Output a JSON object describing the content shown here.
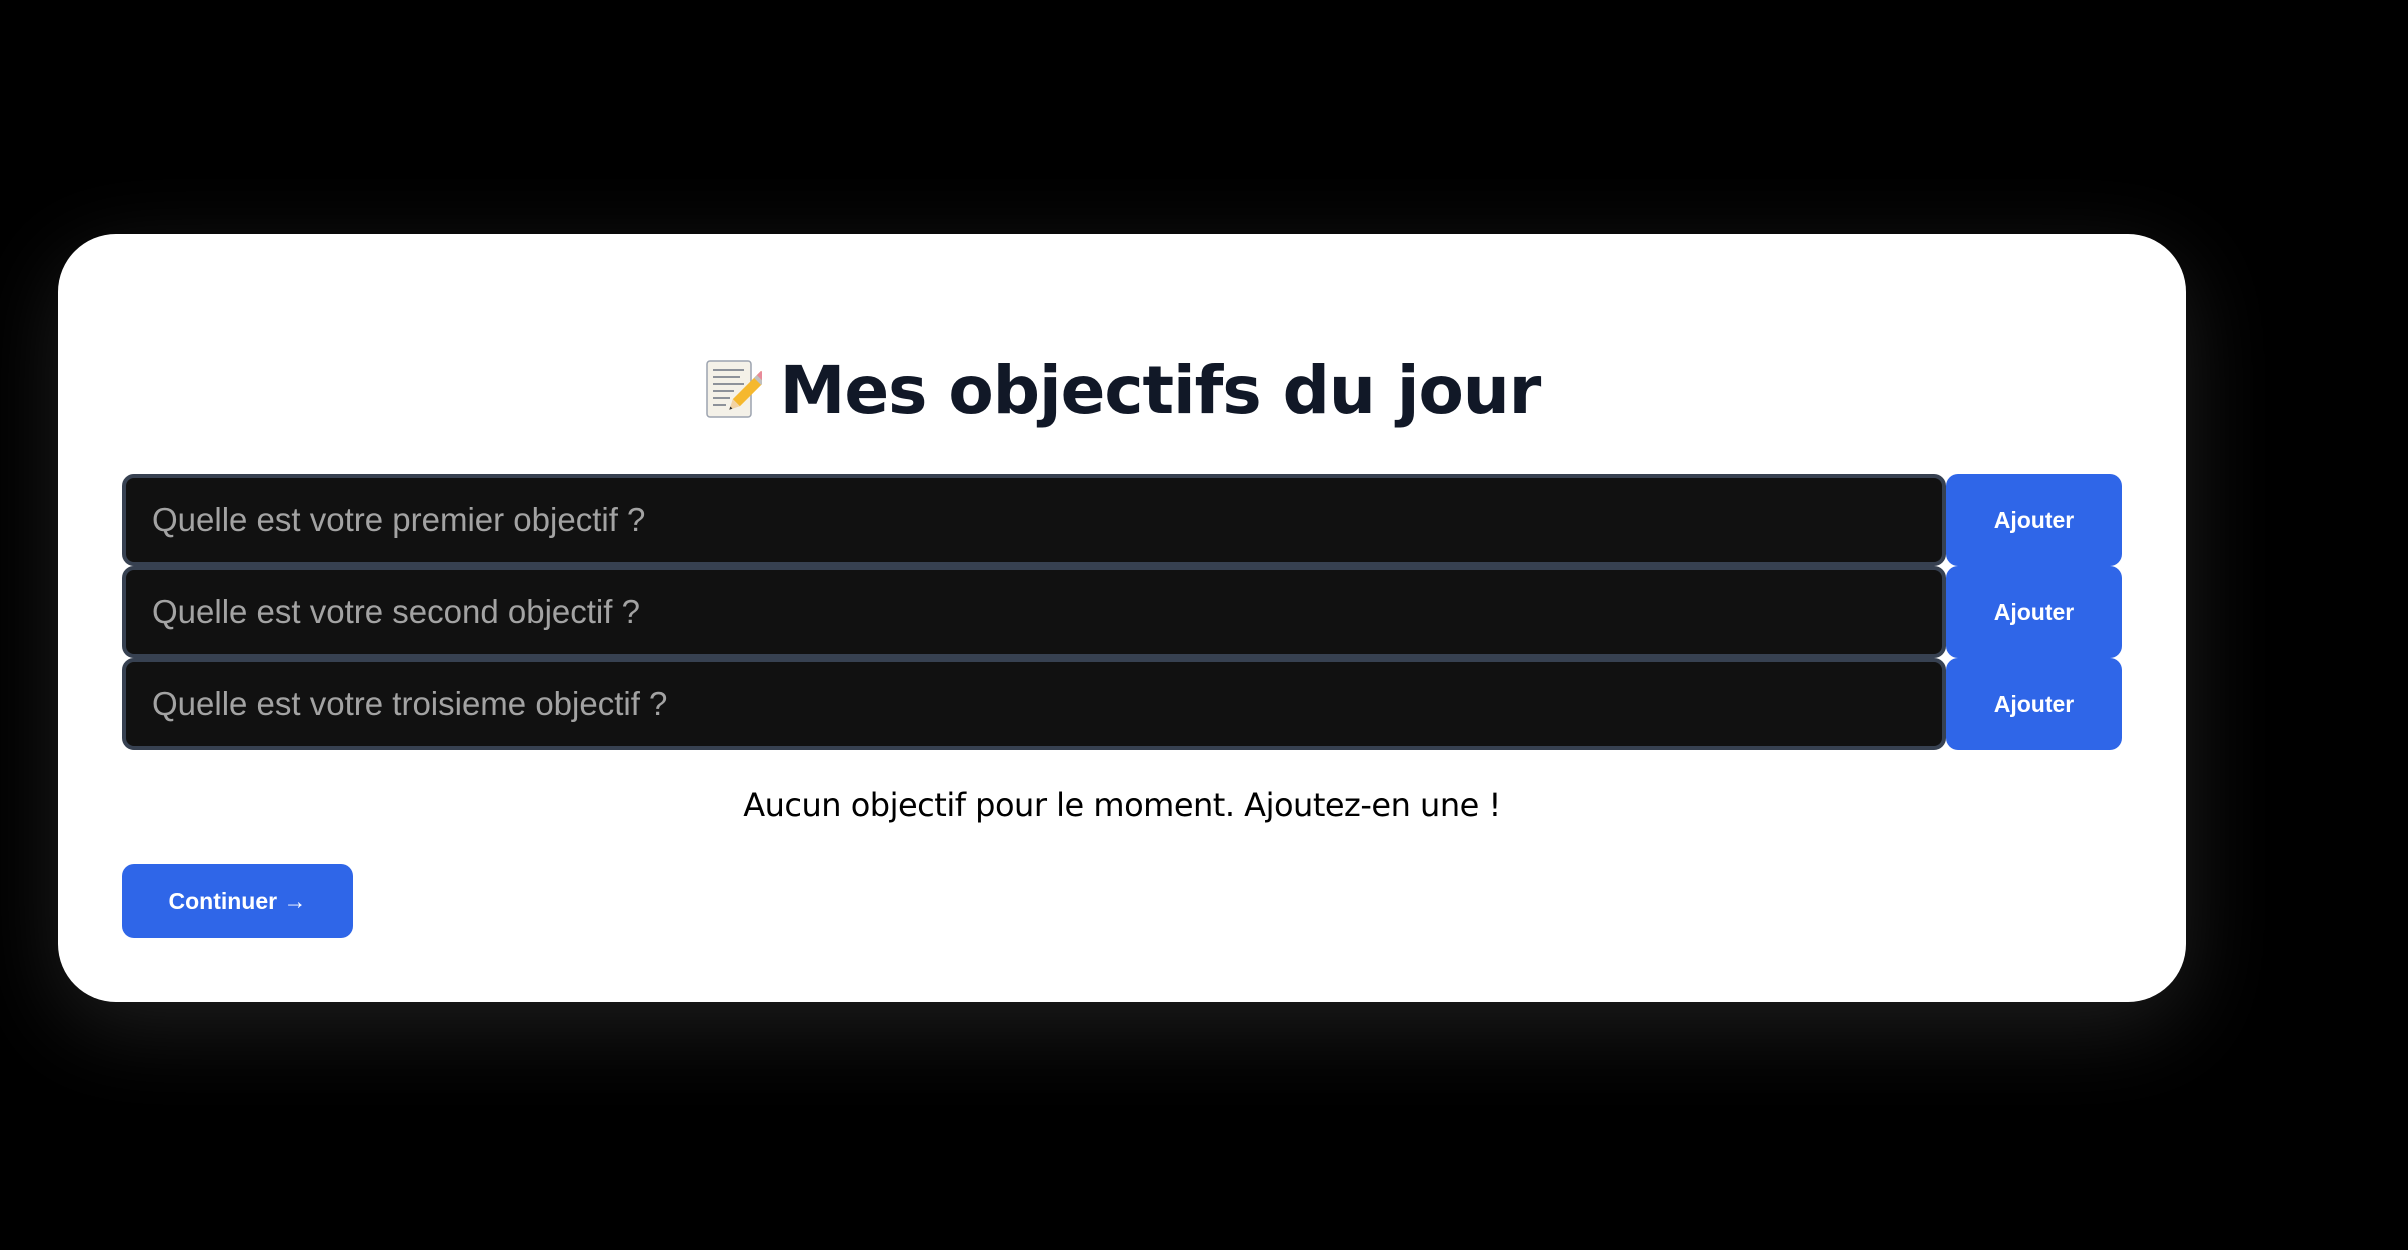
{
  "header": {
    "emoji_icon": "memo-pencil-icon",
    "title": "Mes objectifs du jour"
  },
  "goals": [
    {
      "placeholder": "Quelle est votre premier objectif ?",
      "value": "",
      "button_label": "Ajouter"
    },
    {
      "placeholder": "Quelle est votre second objectif ?",
      "value": "",
      "button_label": "Ajouter"
    },
    {
      "placeholder": "Quelle est votre troisieme objectif ?",
      "value": "",
      "button_label": "Ajouter"
    }
  ],
  "empty_message": "Aucun objectif pour le moment. Ajoutez-en une !",
  "continue_label": "Continuer →",
  "colors": {
    "background": "#000000",
    "card": "#ffffff",
    "accent": "#2f66e8",
    "input_bg": "#111111",
    "input_border": "#374151",
    "title": "#111827"
  }
}
